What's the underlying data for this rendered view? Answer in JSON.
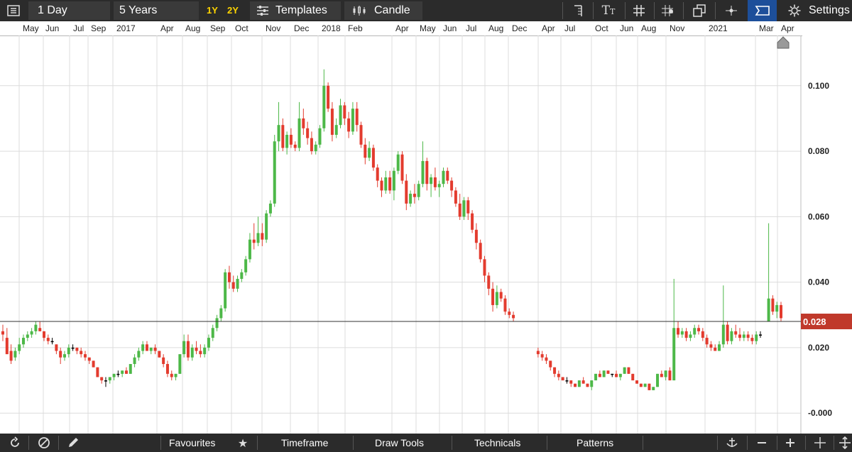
{
  "toolbar": {
    "interval": "1 Day",
    "range": "5 Years",
    "quick_1y": "1Y",
    "quick_2y": "2Y",
    "templates": "Templates",
    "chart_type": "Candle",
    "settings": "Settings"
  },
  "bottom_toolbar": {
    "favourites": "Favourites",
    "timeframe": "Timeframe",
    "draw_tools": "Draw Tools",
    "technicals": "Technicals",
    "patterns": "Patterns"
  },
  "colors": {
    "up": "#4db848",
    "down": "#e33b2e",
    "flat": "#000000",
    "price_badge": "#c0392b",
    "toolbar": "#2b2b2b"
  },
  "chart_data": {
    "type": "candlestick",
    "ylim": [
      -0.002,
      0.11
    ],
    "y_ticks": [
      "0.100",
      "0.080",
      "0.060",
      "0.040",
      "0.020",
      "-0.000"
    ],
    "current_price": "0.028",
    "current_price_value": 0.028,
    "grid": true,
    "x_labels": [
      "May",
      "Jun",
      "Jul",
      "Sep",
      "2017",
      "Apr",
      "Aug",
      "Sep",
      "Oct",
      "Nov",
      "Dec",
      "2018",
      "Feb",
      "Apr",
      "May",
      "Jun",
      "Jul",
      "Aug",
      "Dec",
      "Apr",
      "Jul",
      "Oct",
      "Jun",
      "Aug",
      "Nov",
      "2021",
      "Mar",
      "Apr"
    ],
    "candles": [
      [
        0.025,
        0.027,
        0.022,
        0.024
      ],
      [
        0.023,
        0.026,
        0.019,
        0.018
      ],
      [
        0.019,
        0.021,
        0.015,
        0.016
      ],
      [
        0.017,
        0.02,
        0.016,
        0.019
      ],
      [
        0.019,
        0.023,
        0.018,
        0.021
      ],
      [
        0.021,
        0.024,
        0.02,
        0.023
      ],
      [
        0.023,
        0.025,
        0.022,
        0.024
      ],
      [
        0.024,
        0.026,
        0.023,
        0.025
      ],
      [
        0.025,
        0.028,
        0.024,
        0.027
      ],
      [
        0.026,
        0.028,
        0.025,
        0.025
      ],
      [
        0.025,
        0.025,
        0.022,
        0.023
      ],
      [
        0.023,
        0.024,
        0.021,
        0.022
      ],
      [
        0.022,
        0.023,
        0.021,
        0.022
      ],
      [
        0.021,
        0.021,
        0.018,
        0.019
      ],
      [
        0.019,
        0.02,
        0.015,
        0.017
      ],
      [
        0.017,
        0.019,
        0.016,
        0.018
      ],
      [
        0.018,
        0.021,
        0.017,
        0.02
      ],
      [
        0.02,
        0.021,
        0.019,
        0.02
      ],
      [
        0.02,
        0.02,
        0.018,
        0.019
      ],
      [
        0.019,
        0.02,
        0.017,
        0.018
      ],
      [
        0.018,
        0.019,
        0.016,
        0.017
      ],
      [
        0.017,
        0.017,
        0.015,
        0.016
      ],
      [
        0.016,
        0.016,
        0.014,
        0.014
      ],
      [
        0.014,
        0.014,
        0.011,
        0.011
      ],
      [
        0.011,
        0.011,
        0.009,
        0.01
      ],
      [
        0.01,
        0.011,
        0.008,
        0.01
      ],
      [
        0.01,
        0.011,
        0.009,
        0.011
      ],
      [
        0.011,
        0.012,
        0.01,
        0.012
      ],
      [
        0.012,
        0.013,
        0.011,
        0.012
      ],
      [
        0.012,
        0.013,
        0.011,
        0.013
      ],
      [
        0.013,
        0.014,
        0.012,
        0.012
      ],
      [
        0.012,
        0.015,
        0.012,
        0.015
      ],
      [
        0.015,
        0.018,
        0.014,
        0.017
      ],
      [
        0.017,
        0.02,
        0.016,
        0.019
      ],
      [
        0.019,
        0.022,
        0.018,
        0.021
      ],
      [
        0.021,
        0.022,
        0.019,
        0.019
      ],
      [
        0.019,
        0.02,
        0.018,
        0.02
      ],
      [
        0.02,
        0.021,
        0.018,
        0.019
      ],
      [
        0.019,
        0.019,
        0.017,
        0.017
      ],
      [
        0.017,
        0.018,
        0.014,
        0.015
      ],
      [
        0.015,
        0.016,
        0.011,
        0.012
      ],
      [
        0.012,
        0.013,
        0.01,
        0.011
      ],
      [
        0.011,
        0.012,
        0.01,
        0.012
      ],
      [
        0.012,
        0.018,
        0.012,
        0.018
      ],
      [
        0.018,
        0.024,
        0.017,
        0.022
      ],
      [
        0.022,
        0.024,
        0.016,
        0.017
      ],
      [
        0.017,
        0.021,
        0.016,
        0.02
      ],
      [
        0.02,
        0.022,
        0.018,
        0.019
      ],
      [
        0.019,
        0.021,
        0.017,
        0.018
      ],
      [
        0.018,
        0.021,
        0.017,
        0.02
      ],
      [
        0.02,
        0.024,
        0.019,
        0.023
      ],
      [
        0.023,
        0.027,
        0.022,
        0.026
      ],
      [
        0.026,
        0.03,
        0.025,
        0.029
      ],
      [
        0.029,
        0.033,
        0.028,
        0.032
      ],
      [
        0.032,
        0.044,
        0.031,
        0.043
      ],
      [
        0.043,
        0.045,
        0.038,
        0.04
      ],
      [
        0.04,
        0.042,
        0.037,
        0.038
      ],
      [
        0.038,
        0.042,
        0.037,
        0.041
      ],
      [
        0.041,
        0.044,
        0.04,
        0.043
      ],
      [
        0.043,
        0.048,
        0.042,
        0.047
      ],
      [
        0.047,
        0.055,
        0.046,
        0.053
      ],
      [
        0.053,
        0.058,
        0.05,
        0.052
      ],
      [
        0.052,
        0.06,
        0.051,
        0.055
      ],
      [
        0.055,
        0.058,
        0.051,
        0.053
      ],
      [
        0.053,
        0.062,
        0.052,
        0.061
      ],
      [
        0.061,
        0.065,
        0.06,
        0.064
      ],
      [
        0.064,
        0.085,
        0.063,
        0.083
      ],
      [
        0.083,
        0.095,
        0.08,
        0.088
      ],
      [
        0.088,
        0.09,
        0.08,
        0.081
      ],
      [
        0.081,
        0.086,
        0.079,
        0.085
      ],
      [
        0.085,
        0.087,
        0.081,
        0.082
      ],
      [
        0.082,
        0.083,
        0.08,
        0.081
      ],
      [
        0.081,
        0.095,
        0.08,
        0.09
      ],
      [
        0.09,
        0.093,
        0.085,
        0.087
      ],
      [
        0.087,
        0.089,
        0.082,
        0.084
      ],
      [
        0.084,
        0.086,
        0.079,
        0.08
      ],
      [
        0.08,
        0.083,
        0.079,
        0.082
      ],
      [
        0.082,
        0.088,
        0.081,
        0.087
      ],
      [
        0.087,
        0.105,
        0.086,
        0.1
      ],
      [
        0.1,
        0.101,
        0.092,
        0.093
      ],
      [
        0.093,
        0.095,
        0.083,
        0.085
      ],
      [
        0.085,
        0.09,
        0.084,
        0.088
      ],
      [
        0.088,
        0.096,
        0.087,
        0.094
      ],
      [
        0.094,
        0.095,
        0.088,
        0.09
      ],
      [
        0.09,
        0.092,
        0.084,
        0.086
      ],
      [
        0.086,
        0.095,
        0.085,
        0.093
      ],
      [
        0.093,
        0.095,
        0.086,
        0.088
      ],
      [
        0.088,
        0.089,
        0.081,
        0.082
      ],
      [
        0.082,
        0.084,
        0.076,
        0.078
      ],
      [
        0.078,
        0.083,
        0.077,
        0.081
      ],
      [
        0.081,
        0.082,
        0.074,
        0.075
      ],
      [
        0.075,
        0.076,
        0.069,
        0.071
      ],
      [
        0.071,
        0.072,
        0.066,
        0.068
      ],
      [
        0.068,
        0.074,
        0.067,
        0.072
      ],
      [
        0.072,
        0.074,
        0.067,
        0.068
      ],
      [
        0.068,
        0.075,
        0.065,
        0.074
      ],
      [
        0.074,
        0.08,
        0.073,
        0.079
      ],
      [
        0.079,
        0.08,
        0.07,
        0.071
      ],
      [
        0.071,
        0.073,
        0.062,
        0.064
      ],
      [
        0.064,
        0.068,
        0.063,
        0.067
      ],
      [
        0.067,
        0.07,
        0.064,
        0.066
      ],
      [
        0.066,
        0.071,
        0.065,
        0.07
      ],
      [
        0.07,
        0.083,
        0.069,
        0.077
      ],
      [
        0.077,
        0.078,
        0.068,
        0.07
      ],
      [
        0.07,
        0.073,
        0.066,
        0.072
      ],
      [
        0.072,
        0.075,
        0.068,
        0.069
      ],
      [
        0.069,
        0.071,
        0.066,
        0.07
      ],
      [
        0.07,
        0.075,
        0.069,
        0.074
      ],
      [
        0.074,
        0.075,
        0.07,
        0.071
      ],
      [
        0.071,
        0.072,
        0.066,
        0.068
      ],
      [
        0.068,
        0.069,
        0.063,
        0.064
      ],
      [
        0.064,
        0.067,
        0.059,
        0.06
      ],
      [
        0.06,
        0.066,
        0.059,
        0.065
      ],
      [
        0.065,
        0.066,
        0.059,
        0.061
      ],
      [
        0.061,
        0.062,
        0.055,
        0.056
      ],
      [
        0.056,
        0.058,
        0.05,
        0.052
      ],
      [
        0.052,
        0.053,
        0.046,
        0.047
      ],
      [
        0.047,
        0.048,
        0.04,
        0.042
      ],
      [
        0.042,
        0.043,
        0.036,
        0.038
      ],
      [
        0.038,
        0.04,
        0.031,
        0.033
      ],
      [
        0.033,
        0.039,
        0.032,
        0.037
      ],
      [
        0.037,
        0.038,
        0.034,
        0.035
      ],
      [
        0.035,
        0.036,
        0.03,
        0.031
      ],
      [
        0.031,
        0.032,
        0.029,
        0.03
      ],
      [
        0.03,
        0.031,
        0.028,
        0.029
      ],
      null,
      null,
      null,
      null,
      null,
      [
        0.019,
        0.02,
        0.017,
        0.018
      ],
      [
        0.018,
        0.019,
        0.016,
        0.017
      ],
      [
        0.017,
        0.018,
        0.015,
        0.016
      ],
      [
        0.016,
        0.016,
        0.013,
        0.014
      ],
      [
        0.014,
        0.014,
        0.011,
        0.012
      ],
      [
        0.012,
        0.013,
        0.01,
        0.011
      ],
      [
        0.011,
        0.011,
        0.01,
        0.01
      ],
      [
        0.01,
        0.011,
        0.009,
        0.01
      ],
      [
        0.01,
        0.01,
        0.008,
        0.009
      ],
      [
        0.009,
        0.009,
        0.008,
        0.008
      ],
      [
        0.008,
        0.01,
        0.008,
        0.01
      ],
      [
        0.01,
        0.011,
        0.009,
        0.009
      ],
      [
        0.009,
        0.009,
        0.008,
        0.008
      ],
      [
        0.008,
        0.01,
        0.007,
        0.01
      ],
      [
        0.01,
        0.012,
        0.01,
        0.012
      ],
      [
        0.012,
        0.013,
        0.011,
        0.011
      ],
      [
        0.011,
        0.013,
        0.011,
        0.013
      ],
      [
        0.013,
        0.013,
        0.012,
        0.012
      ],
      [
        0.012,
        0.012,
        0.011,
        0.012
      ],
      [
        0.012,
        0.013,
        0.011,
        0.011
      ],
      [
        0.011,
        0.012,
        0.01,
        0.012
      ],
      [
        0.012,
        0.014,
        0.012,
        0.014
      ],
      [
        0.014,
        0.014,
        0.012,
        0.012
      ],
      [
        0.012,
        0.012,
        0.01,
        0.01
      ],
      [
        0.01,
        0.01,
        0.009,
        0.009
      ],
      [
        0.009,
        0.009,
        0.008,
        0.008
      ],
      [
        0.008,
        0.009,
        0.008,
        0.009
      ],
      [
        0.009,
        0.009,
        0.007,
        0.007
      ],
      [
        0.007,
        0.008,
        0.007,
        0.008
      ],
      [
        0.008,
        0.012,
        0.008,
        0.012
      ],
      [
        0.012,
        0.013,
        0.011,
        0.011
      ],
      [
        0.011,
        0.013,
        0.01,
        0.013
      ],
      [
        0.013,
        0.014,
        0.01,
        0.01
      ],
      [
        0.01,
        0.041,
        0.01,
        0.026
      ],
      [
        0.026,
        0.028,
        0.023,
        0.024
      ],
      [
        0.024,
        0.026,
        0.023,
        0.025
      ],
      [
        0.025,
        0.026,
        0.022,
        0.023
      ],
      [
        0.023,
        0.025,
        0.022,
        0.024
      ],
      [
        0.024,
        0.027,
        0.023,
        0.026
      ],
      [
        0.026,
        0.027,
        0.024,
        0.025
      ],
      [
        0.025,
        0.026,
        0.022,
        0.023
      ],
      [
        0.023,
        0.024,
        0.02,
        0.021
      ],
      [
        0.021,
        0.022,
        0.019,
        0.02
      ],
      [
        0.02,
        0.021,
        0.019,
        0.019
      ],
      [
        0.019,
        0.022,
        0.019,
        0.021
      ],
      [
        0.021,
        0.039,
        0.02,
        0.027
      ],
      [
        0.027,
        0.028,
        0.021,
        0.022
      ],
      [
        0.022,
        0.026,
        0.021,
        0.025
      ],
      [
        0.025,
        0.027,
        0.023,
        0.024
      ],
      [
        0.024,
        0.026,
        0.022,
        0.023
      ],
      [
        0.023,
        0.025,
        0.022,
        0.024
      ],
      [
        0.024,
        0.025,
        0.022,
        0.023
      ],
      [
        0.023,
        0.024,
        0.021,
        0.022
      ],
      [
        0.022,
        0.025,
        0.021,
        0.024
      ],
      [
        0.024,
        0.025,
        0.023,
        0.024
      ],
      null,
      [
        0.028,
        0.058,
        0.028,
        0.035
      ],
      [
        0.035,
        0.036,
        0.03,
        0.031
      ],
      [
        0.031,
        0.034,
        0.029,
        0.033
      ],
      [
        0.033,
        0.034,
        0.028,
        0.029
      ]
    ]
  }
}
